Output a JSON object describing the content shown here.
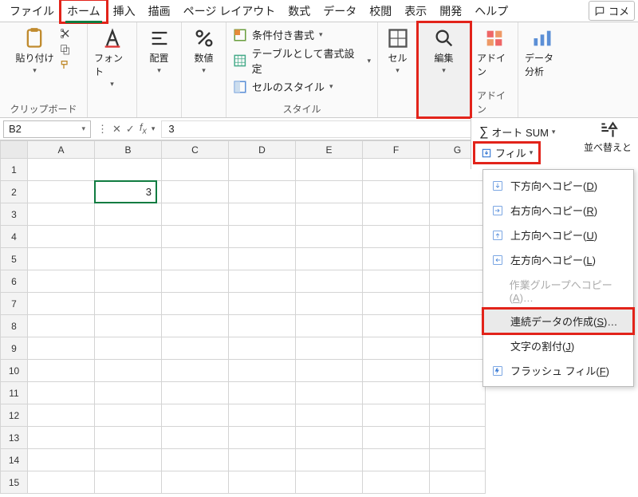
{
  "menu": {
    "file": "ファイル",
    "home": "ホーム",
    "insert": "挿入",
    "draw": "描画",
    "page_layout": "ページ レイアウト",
    "formulas": "数式",
    "data": "データ",
    "review": "校閲",
    "view": "表示",
    "developer": "開発",
    "help": "ヘルプ",
    "comment": "コメ"
  },
  "ribbon": {
    "paste": "貼り付け",
    "clipboard": "クリップボード",
    "font": "フォント",
    "align": "配置",
    "number": "数値",
    "cond_fmt": "条件付き書式",
    "as_table": "テーブルとして書式設定",
    "cell_styles": "セルのスタイル",
    "styles": "スタイル",
    "cell": "セル",
    "edit": "編集",
    "addin": "アドイン",
    "data_analysis": "データ分析"
  },
  "edit_panel": {
    "autosum": "オート SUM",
    "fill": "フィル",
    "sort": "並べ替えと"
  },
  "fill_menu": {
    "down": "下方向へコピー(",
    "down_k": "D",
    "right": "右方向へコピー(",
    "right_k": "R",
    "up": "上方向へコピー(",
    "up_k": "U",
    "left": "左方向へコピー(",
    "left_k": "L",
    "across": "作業グループへコピー(",
    "across_k": "A",
    "across_tail": ")…",
    "series": "連続データの作成(",
    "series_k": "S",
    "series_tail": ")…",
    "justify": "文字の割付(",
    "justify_k": "J",
    "flash": "フラッシュ フィル(",
    "flash_k": "F",
    "close": ")"
  },
  "fbar": {
    "name": "B2",
    "formula": "3"
  },
  "sheet": {
    "cols": [
      "A",
      "B",
      "C",
      "D",
      "E",
      "F",
      "G"
    ],
    "rows": [
      "1",
      "2",
      "3",
      "4",
      "5",
      "6",
      "7",
      "8",
      "9",
      "10",
      "11",
      "12",
      "13",
      "14",
      "15"
    ],
    "b2": "3"
  }
}
